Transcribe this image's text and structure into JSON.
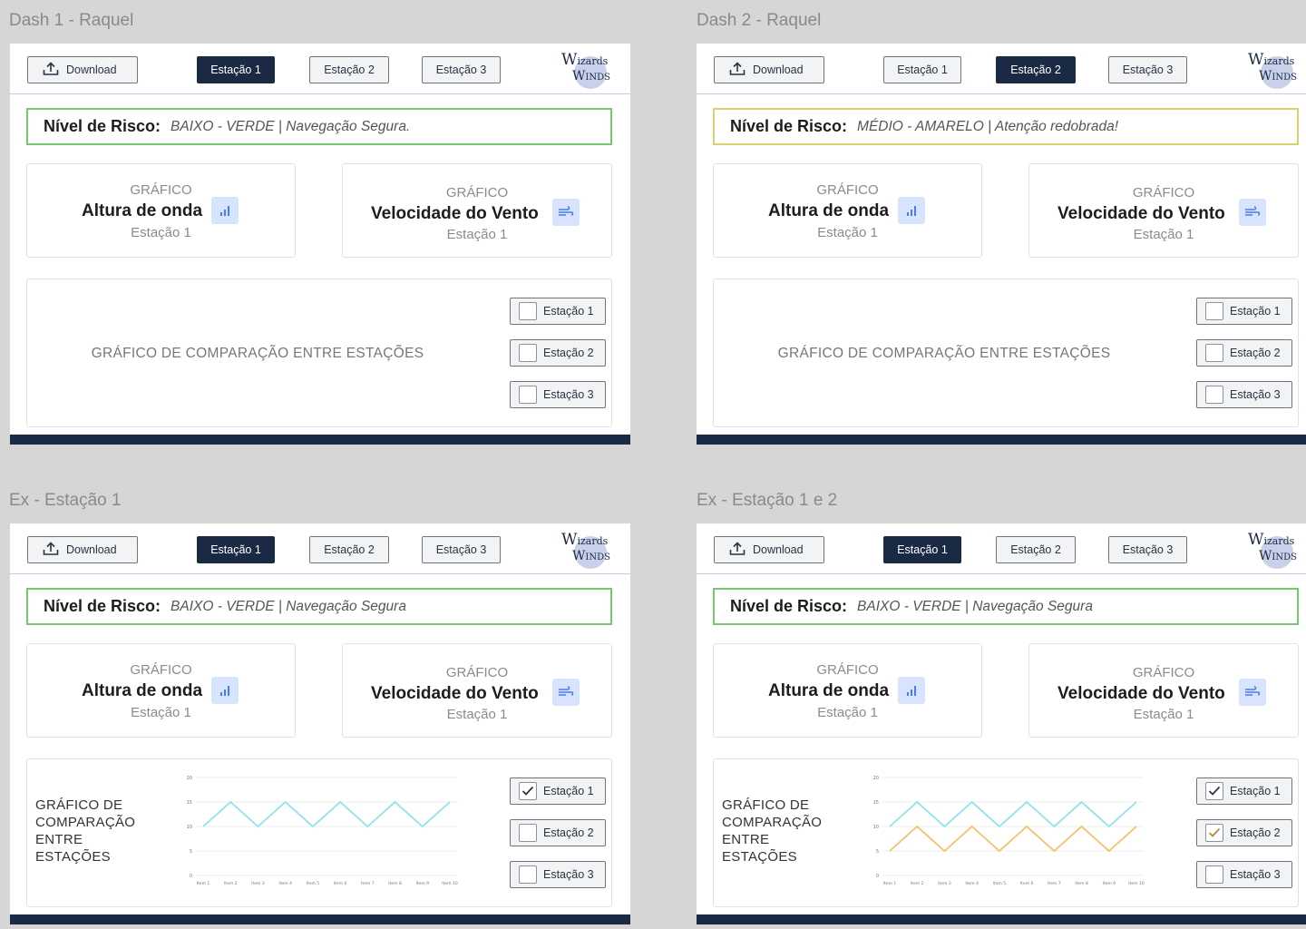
{
  "common": {
    "download_label": "Download",
    "station_labels": [
      "Estação 1",
      "Estação 2",
      "Estação 3"
    ],
    "logo_line1": [
      "W",
      "izards"
    ],
    "logo_line2": [
      "W",
      "INDS"
    ],
    "risk_key": "Nível de Risco:",
    "wave_card": {
      "caption": "GRÁFICO",
      "title": "Altura de onda",
      "subtitle": "Estação 1",
      "icon": "bar-chart-icon"
    },
    "wind_card": {
      "caption": "GRÁFICO",
      "title": "Velocidade do Vento",
      "subtitle": "Estação 1",
      "icon": "wind-icon"
    },
    "comparison_title": "GRÁFICO DE COMPARAÇÃO ENTRE ESTAÇÕES",
    "comparison_title_wrapped": [
      "GRÁFICO DE",
      "COMPARAÇÃO",
      "ENTRE",
      "ESTAÇÕES"
    ],
    "checkboxes": [
      "Estação 1",
      "Estação 2",
      "Estação 3"
    ]
  },
  "frames": [
    {
      "label": "Dash 1 -  Raquel",
      "active_station": 1,
      "risk_value": "BAIXO - VERDE | Navegação Segura.",
      "risk_color": "#76c86e",
      "checked": [
        false,
        false,
        false
      ],
      "has_chart": false
    },
    {
      "label": "Dash 2 -  Raquel",
      "active_station": 2,
      "risk_value": "MÉDIO - AMARELO | Atenção redobrada!",
      "risk_color": "#d9d26a",
      "checked": [
        false,
        false,
        false
      ],
      "has_chart": false
    },
    {
      "label": "Ex - Estação 1",
      "active_station": 1,
      "risk_value": "BAIXO - VERDE | Navegação Segura",
      "risk_color": "#76c86e",
      "checked": [
        true,
        false,
        false
      ],
      "has_chart": true
    },
    {
      "label": "Ex - Estação 1 e 2",
      "active_station": 1,
      "risk_value": "BAIXO - VERDE | Navegação Segura",
      "risk_color": "#76c86e",
      "checked": [
        true,
        true,
        false
      ],
      "has_chart": true
    }
  ],
  "chart_data": [
    {
      "type": "line",
      "categories": [
        "Item 1",
        "Item 2",
        "Item 3",
        "Item 4",
        "Item 5",
        "Item 6",
        "Item 7",
        "Item 8",
        "Item 9",
        "Item 10"
      ],
      "yticks": [
        "0",
        "5",
        "10",
        "15",
        "20"
      ],
      "ylim": [
        0,
        20
      ],
      "series": [
        {
          "values": [
            10,
            15,
            10,
            15,
            10,
            15,
            10,
            15,
            10,
            15
          ],
          "color": "#8ee3ec"
        }
      ]
    },
    {
      "type": "line",
      "categories": [
        "Item 1",
        "Item 2",
        "Item 3",
        "Item 4",
        "Item 5",
        "Item 6",
        "Item 7",
        "Item 8",
        "Item 9",
        "Item 10"
      ],
      "yticks": [
        "0",
        "5",
        "10",
        "15",
        "20"
      ],
      "ylim": [
        0,
        20
      ],
      "series": [
        {
          "values": [
            10,
            15,
            10,
            15,
            10,
            15,
            10,
            15,
            10,
            15
          ],
          "color": "#8ee3ec"
        },
        {
          "values": [
            5,
            10,
            5,
            10,
            5,
            10,
            5,
            10,
            5,
            10
          ],
          "color": "#f5c26b"
        }
      ]
    }
  ]
}
